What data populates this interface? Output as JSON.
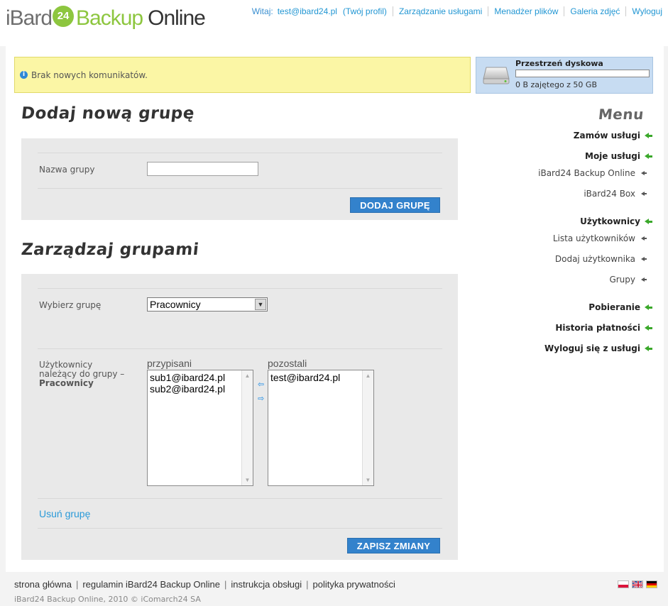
{
  "header": {
    "logo_text_1": "iBard",
    "logo_badge": "24",
    "logo_text_2": "Backup",
    "logo_text_3": "Online",
    "welcome_label": "Witaj:",
    "user_email": "test@ibard24.pl",
    "profile_link": "(Twój profil)",
    "nav": [
      "Zarządzanie usługami",
      "Menadżer plików",
      "Galeria zdjęć",
      "Wyloguj"
    ]
  },
  "messages": {
    "text": "Brak nowych komunikatów."
  },
  "disk": {
    "title": "Przestrzeń dyskowa",
    "usage_text": "0 B zajętego z 50 GB",
    "used_fraction": 0
  },
  "add_group": {
    "heading": "Dodaj nową grupę",
    "name_label": "Nazwa grupy",
    "name_value": "",
    "submit_label": "DODAJ GRUPĘ"
  },
  "manage_groups": {
    "heading": "Zarządzaj grupami",
    "select_label": "Wybierz grupę",
    "selected_group": "Pracownicy",
    "members_label_line1": "Użytkownicy",
    "members_label_line2": "należący do grupy –",
    "members_label_group": "Pracownicy",
    "assigned_header": "przypisani",
    "assigned": [
      "sub1@ibard24.pl",
      "sub2@ibard24.pl"
    ],
    "others_header": "pozostali",
    "others": [
      "test@ibard24.pl"
    ],
    "delete_link": "Usuń grupę",
    "save_label": "ZAPISZ ZMIANY"
  },
  "menu": {
    "title": "Menu",
    "order": "Zamów usługi",
    "my_services": "Moje usługi",
    "my_services_items": [
      "iBard24 Backup Online",
      "iBard24 Box"
    ],
    "users": "Użytkownicy",
    "users_items": [
      "Lista użytkowników",
      "Dodaj użytkownika",
      "Grupy"
    ],
    "downloads": "Pobieranie",
    "payments": "Historia płatności",
    "logout": "Wyloguj się z usługi"
  },
  "footer": {
    "links": [
      "strona główna",
      "regulamin iBard24 Backup Online",
      "instrukcja obsługi",
      "polityka prywatności"
    ],
    "copyright": "iBard24 Backup Online, 2010 © iComarch24 SA"
  },
  "colors": {
    "accent_blue": "#3382cc",
    "brand_green": "#8dc63f",
    "message_yellow": "#fbf6a5"
  }
}
